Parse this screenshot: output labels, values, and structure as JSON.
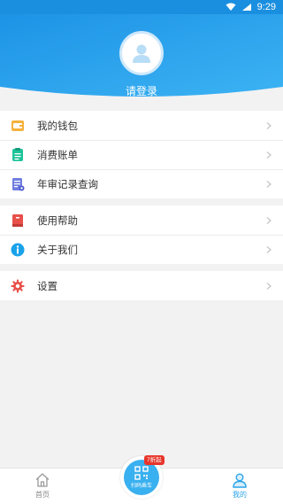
{
  "status_bar": {
    "time": "9:29"
  },
  "header": {
    "login_text": "请登录"
  },
  "menu_groups": [
    {
      "items": [
        {
          "label": "我的钱包",
          "icon": "wallet-icon"
        },
        {
          "label": "消费账单",
          "icon": "bill-icon"
        },
        {
          "label": "年审记录查询",
          "icon": "record-icon"
        }
      ]
    },
    {
      "items": [
        {
          "label": "使用帮助",
          "icon": "help-book-icon"
        },
        {
          "label": "关于我们",
          "icon": "info-icon"
        }
      ]
    },
    {
      "items": [
        {
          "label": "设置",
          "icon": "gear-icon"
        }
      ]
    }
  ],
  "tabbar": {
    "home_label": "首页",
    "scan_label": "扫码乘车",
    "scan_badge": "7折起",
    "me_label": "我的"
  },
  "colors": {
    "primary": "#29a3ea",
    "badge": "#e8352a",
    "background": "#f2f2f2"
  }
}
